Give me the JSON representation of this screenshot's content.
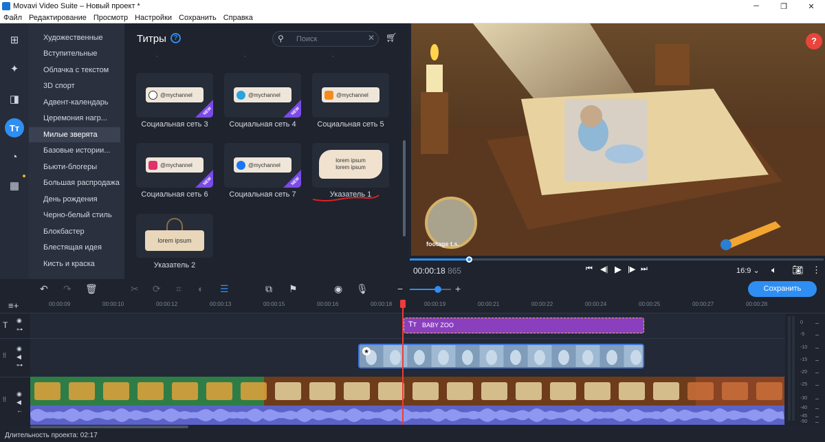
{
  "window": {
    "title": "Movavi Video Suite – Новый проект *"
  },
  "menu": [
    "Файл",
    "Редактирование",
    "Просмотр",
    "Настройки",
    "Сохранить",
    "Справка"
  ],
  "categories": [
    "Художественные",
    "Вступительные",
    "Облачка с текстом",
    "3D спорт",
    "Адвент-календарь",
    "Церемония нагр...",
    "Милые зверята",
    "Базовые истории...",
    "Бьюти-блогеры",
    "Большая распродажа",
    "День рождения",
    "Черно-белый стиль",
    "Блокбастер",
    "Блестящая идея",
    "Кисть и краска"
  ],
  "active_category": "Милые зверята",
  "titles_panel": {
    "heading": "Титры",
    "help": "?",
    "search_placeholder": "Поиск",
    "items": [
      {
        "label": "Социальная сеть 3",
        "channel": "@mychannel",
        "network": "tiktok",
        "new": true
      },
      {
        "label": "Социальная сеть 4",
        "channel": "@mychannel",
        "network": "telegram",
        "new": true
      },
      {
        "label": "Социальная сеть 5",
        "channel": "@mychannel",
        "network": "odnoklassniki",
        "new": false
      },
      {
        "label": "Социальная сеть 6",
        "channel": "@mychannel",
        "network": "instagram",
        "new": true
      },
      {
        "label": "Социальная сеть 7",
        "channel": "@mychannel",
        "network": "facebook",
        "new": true
      },
      {
        "label": "Указатель 1",
        "text1": "lorem ipsum",
        "text2": "lorem ipsum"
      },
      {
        "label": "Указатель 2",
        "text1": "lorem ipsum"
      }
    ],
    "new_badge": "NEW"
  },
  "preview": {
    "help": "?",
    "watermark": "footage t.s."
  },
  "player": {
    "time": "00:00:18",
    "time_ms": "865",
    "progress": 0.145,
    "aspect_ratio": "16:9"
  },
  "toolbar": {
    "save_label": "Сохранить",
    "zoom_level": 0.68
  },
  "timeline": {
    "ticks": [
      "00:00:09",
      "00:00:10",
      "00:00:12",
      "00:00:13",
      "00:00:15",
      "00:00:16",
      "00:00:18",
      "00:00:19",
      "00:00:21",
      "00:00:22",
      "00:00:24",
      "00:00:25",
      "00:00:27",
      "00:00:28"
    ],
    "title_clip": "BABY ZOO",
    "meter_labels": [
      "0",
      "-5",
      "-10",
      "-15",
      "-20",
      "-25",
      "-30",
      "-40",
      "-45",
      "-50"
    ]
  },
  "status": {
    "duration": "Длительность проекта: 02:17"
  },
  "colors": {
    "accent": "#2f8ef2",
    "new_badge": "#7b4ae8",
    "title_clip": "#8a3fbf",
    "playhead": "#ef3b3b"
  }
}
